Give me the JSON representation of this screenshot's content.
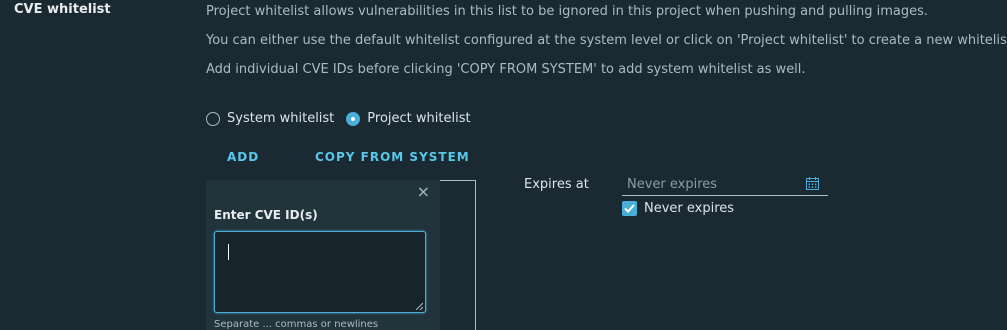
{
  "section": {
    "label": "CVE whitelist"
  },
  "description": [
    "Project whitelist allows vulnerabilities in this list to be ignored in this project when pushing and pulling images.",
    "You can either use the default whitelist configured at the system level or click on 'Project whitelist' to create a new whitelist",
    "Add individual CVE IDs before clicking 'COPY FROM SYSTEM' to add system whitelist as well."
  ],
  "radios": [
    {
      "label": "System whitelist",
      "selected": false
    },
    {
      "label": "Project whitelist",
      "selected": true
    }
  ],
  "actions": {
    "add": "ADD",
    "copy": "COPY FROM SYSTEM"
  },
  "popover": {
    "close_icon": "×",
    "title": "Enter CVE ID(s)",
    "input_value": "",
    "helper_text": "Separate",
    "helper_partial": "Separate ... commas or newlines"
  },
  "expiry": {
    "label": "Expires at",
    "placeholder": "Never expires",
    "checkbox_label": "Never expires",
    "checkbox_checked": true
  },
  "colors": {
    "background": "#1b2a32",
    "accent": "#49afd9",
    "link": "#57c8ea",
    "text": "#acbac3"
  },
  "icons": {
    "calendar": "calendar-icon",
    "close": "close-icon",
    "check": "check-icon",
    "resize": "resize-grip-icon"
  }
}
